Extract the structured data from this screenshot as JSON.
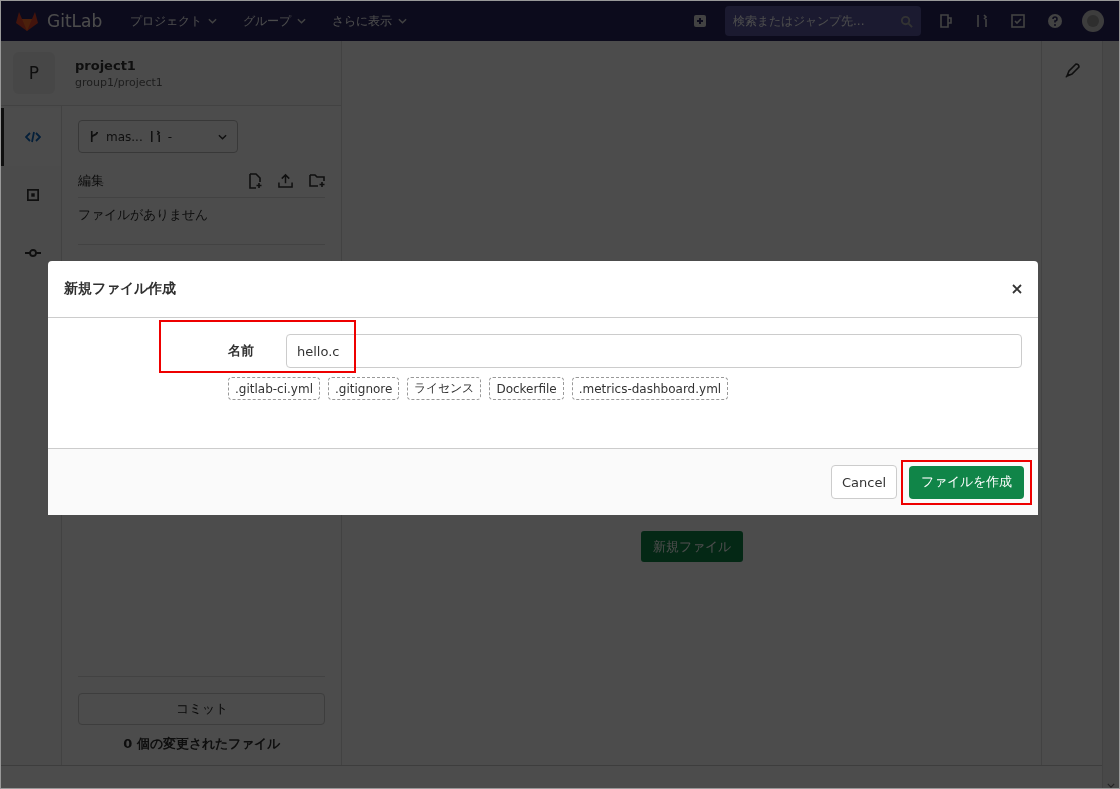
{
  "navbar": {
    "logo": "GitLab",
    "menus": [
      {
        "label": "プロジェクト"
      },
      {
        "label": "グループ"
      },
      {
        "label": "さらに表示"
      }
    ],
    "search": {
      "placeholder": "検索またはジャンプ先..."
    }
  },
  "project": {
    "avatar": "P",
    "name": "project1",
    "path": "group1/project1"
  },
  "rail": [
    {
      "kind": "code",
      "selected": true
    },
    {
      "kind": "review",
      "selected": false
    },
    {
      "kind": "commit",
      "selected": false
    }
  ],
  "branch": {
    "name": "mas...",
    "merge_request": "-"
  },
  "file_panel": {
    "title": "編集",
    "empty": "ファイルがありません"
  },
  "commit": {
    "button": "コミット",
    "disabled": true,
    "summary": "0 個の変更されたファイル"
  },
  "main": {
    "new_file_button": "新規ファイル"
  },
  "modal": {
    "title": "新規ファイル作成",
    "name_label": "名前",
    "name_value": "hello.c",
    "name_highlighted": true,
    "templates": [
      ".gitlab-ci.yml",
      ".gitignore",
      "ライセンス",
      "Dockerfile",
      ".metrics-dashboard.yml"
    ],
    "cancel": "Cancel",
    "submit": "ファイルを作成",
    "submit_highlighted": true
  }
}
